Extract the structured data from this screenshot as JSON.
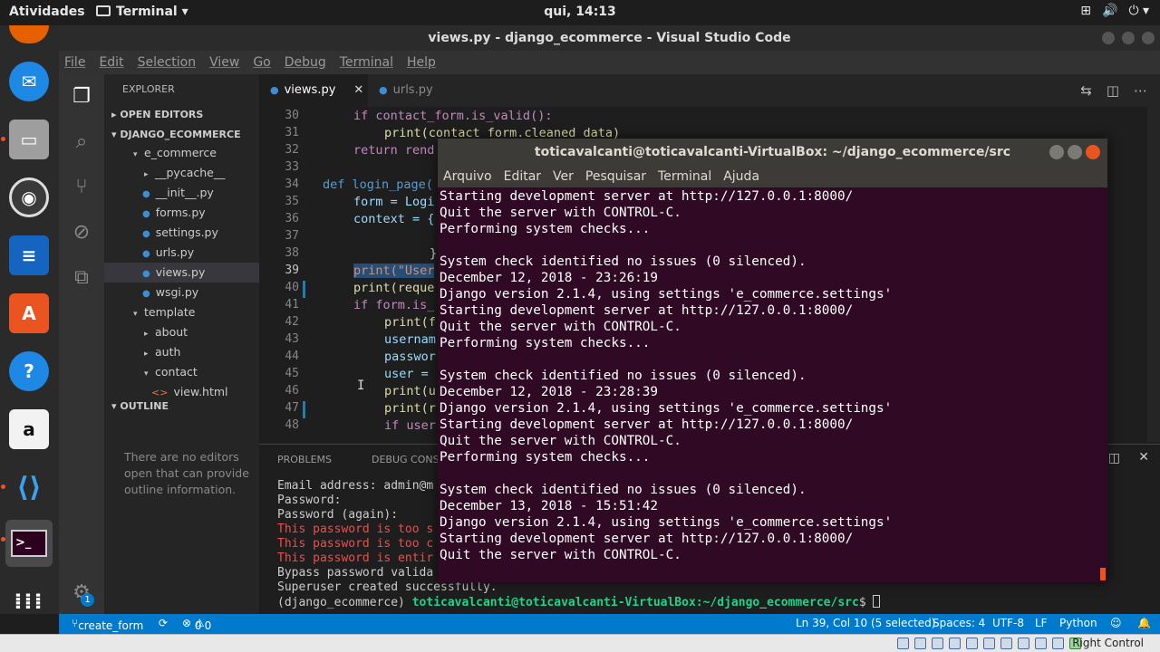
{
  "topbar": {
    "activities": "Atividades",
    "app_name": "Terminal",
    "clock": "qui, 14:13"
  },
  "vscode": {
    "title": "views.py - django_ecommerce - Visual Studio Code",
    "menu": [
      "File",
      "Edit",
      "Selection",
      "View",
      "Go",
      "Debug",
      "Terminal",
      "Help"
    ],
    "sidebar": {
      "explorer_label": "EXPLORER",
      "open_editors": "OPEN EDITORS",
      "project": "DJANGO_ECOMMERCE",
      "tree": [
        "e_commerce",
        "__pycache__",
        "__init__.py",
        "forms.py",
        "settings.py",
        "urls.py",
        "views.py",
        "wsgi.py",
        "template",
        "about",
        "auth",
        "contact",
        "view.html"
      ],
      "outline": "OUTLINE",
      "outline_message": "There are no editors open that can provide outline information."
    },
    "tabs": [
      {
        "label": "views.py"
      },
      {
        "label": "urls.py"
      }
    ],
    "editor": {
      "line_numbers": [
        "30",
        "31",
        "32",
        "33",
        "34",
        "35",
        "36",
        "37",
        "38",
        "39",
        "40",
        "41",
        "42",
        "43",
        "44",
        "45",
        "46",
        "47",
        "48"
      ],
      "lines": [
        "if contact_form.is_valid():",
        "print(contact_form.cleaned_data)",
        "return rend",
        "",
        "def login_page(",
        "form = Logi",
        "context = {",
        "",
        "}",
        "print(\"User",
        "print(reque",
        "if form.is_",
        "print(f",
        "usernam",
        "passwor",
        "user =",
        "print(u",
        "print(r",
        "if user"
      ]
    },
    "panel": {
      "tab_problems": "PROBLEMS",
      "tab_debug": "DEBUG CONSOLE",
      "lines": [
        "Email address: admin@m",
        "Password:",
        "Password (again):",
        "This password is too s",
        "This password is too c",
        "This password is entir",
        "Bypass password valida",
        "Superuser created successfully."
      ],
      "prompt_env": "(django_ecommerce)",
      "prompt_user": "toticavalcanti@toticavalcanti-VirtualBox",
      "prompt_path": ":~/django_ecommerce/src",
      "prompt_end": "$ "
    },
    "status": {
      "branch": "create_form",
      "errors": "0",
      "warnings": "0",
      "cursor": "Ln 39, Col 10 (5 selected)",
      "spaces": "Spaces: 4",
      "encoding": "UTF-8",
      "eol": "LF",
      "language": "Python",
      "badge": "1"
    }
  },
  "terminal": {
    "title": "toticavalcanti@toticavalcanti-VirtualBox: ~/django_ecommerce/src",
    "menu": [
      "Arquivo",
      "Editar",
      "Ver",
      "Pesquisar",
      "Terminal",
      "Ajuda"
    ],
    "lines": [
      "Starting development server at http://127.0.0.1:8000/",
      "Quit the server with CONTROL-C.",
      "Performing system checks...",
      "",
      "System check identified no issues (0 silenced).",
      "December 12, 2018 - 23:26:19",
      "Django version 2.1.4, using settings 'e_commerce.settings'",
      "Starting development server at http://127.0.0.1:8000/",
      "Quit the server with CONTROL-C.",
      "Performing system checks...",
      "",
      "System check identified no issues (0 silenced).",
      "December 12, 2018 - 23:28:39",
      "Django version 2.1.4, using settings 'e_commerce.settings'",
      "Starting development server at http://127.0.0.1:8000/",
      "Quit the server with CONTROL-C.",
      "Performing system checks...",
      "",
      "System check identified no issues (0 silenced).",
      "December 13, 2018 - 15:51:42",
      "Django version 2.1.4, using settings 'e_commerce.settings'",
      "Starting development server at http://127.0.0.1:8000/",
      "Quit the server with CONTROL-C."
    ]
  },
  "tray": {
    "host_key": "Right Control"
  }
}
